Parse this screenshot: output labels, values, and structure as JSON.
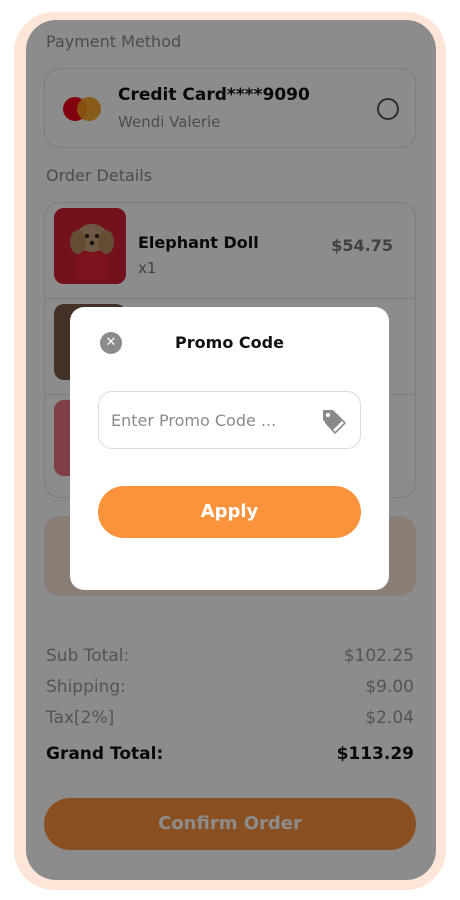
{
  "payment": {
    "section_label": "Payment Method",
    "card_title": "Credit Card****9090",
    "card_holder": "Wendi Valerie"
  },
  "order": {
    "section_label": "Order Details",
    "items": [
      {
        "name": "Elephant Doll",
        "qty": "x1",
        "price": "$54.75"
      },
      {
        "name": "",
        "qty": "",
        "price": ""
      },
      {
        "name": "",
        "qty": "",
        "price": ""
      }
    ]
  },
  "summary": {
    "subtotal_label": "Sub Total:",
    "subtotal_value": "$102.25",
    "shipping_label": "Shipping:",
    "shipping_value": "$9.00",
    "tax_label": "Tax[2%]",
    "tax_value": "$2.04",
    "grand_label": "Grand Total:",
    "grand_value": "$113.29"
  },
  "confirm_label": "Confirm Order",
  "modal": {
    "title": "Promo Code",
    "input_placeholder": "Enter Promo Code ...",
    "apply_label": "Apply"
  },
  "colors": {
    "accent": "#fb923c",
    "frame": "#fde6d8"
  }
}
